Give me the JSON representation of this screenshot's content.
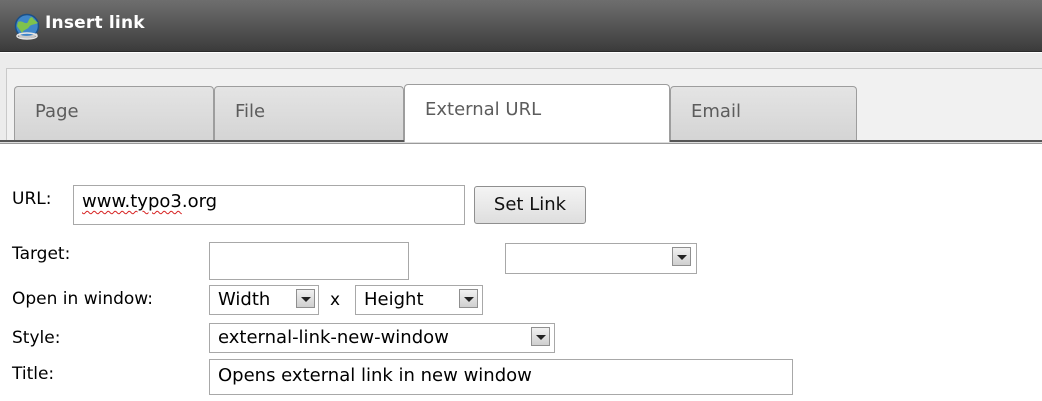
{
  "window": {
    "title": "Insert link",
    "icon": "globe-icon"
  },
  "tabs": [
    {
      "label": "Page",
      "active": false
    },
    {
      "label": "File",
      "active": false
    },
    {
      "label": "External URL",
      "active": true
    },
    {
      "label": "Email",
      "active": false
    }
  ],
  "form": {
    "url_label": "URL:",
    "url_value_underlined": "www.typo3",
    "url_value_rest": ".org",
    "set_link_label": "Set Link",
    "target_label": "Target:",
    "target_value": "",
    "target_select_value": "",
    "open_in_window_label": "Open in window:",
    "width_value": "Width",
    "times_symbol": "x",
    "height_value": "Height",
    "style_label": "Style:",
    "style_value": "external-link-new-window",
    "title_label": "Title:",
    "title_value": "Opens external link in new window"
  }
}
